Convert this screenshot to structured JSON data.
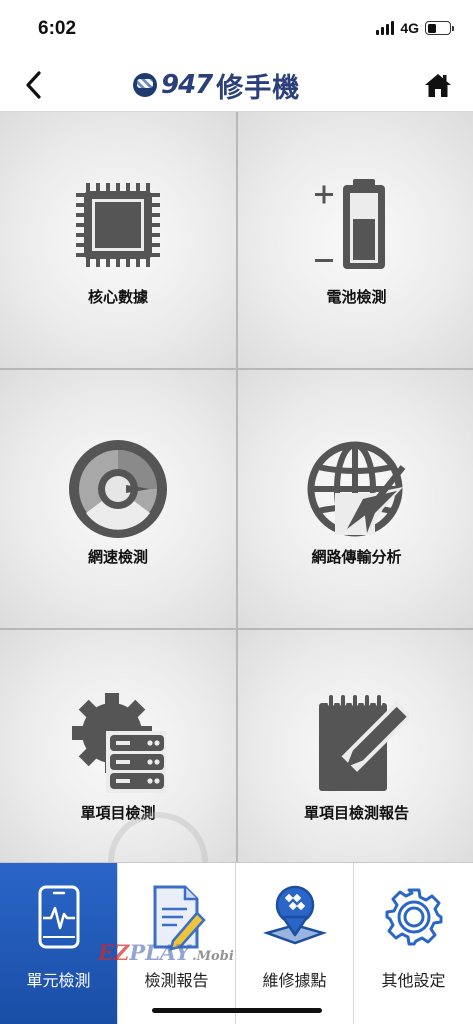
{
  "status_bar": {
    "time": "6:02",
    "network": "4G"
  },
  "nav": {
    "logo_number": "947",
    "logo_text": "修手機"
  },
  "tiles": [
    {
      "label": "核心數據",
      "icon": "cpu-chip-icon"
    },
    {
      "label": "電池檢測",
      "icon": "battery-level-icon"
    },
    {
      "label": "網速檢測",
      "icon": "speedometer-icon"
    },
    {
      "label": "網路傳輸分析",
      "icon": "globe-cursor-icon"
    },
    {
      "label": "單項目檢測",
      "icon": "gear-server-icon"
    },
    {
      "label": "單項目檢測報告",
      "icon": "notepad-pencil-icon"
    }
  ],
  "tabs": [
    {
      "label": "單元檢測",
      "icon": "phone-pulse-icon",
      "active": true
    },
    {
      "label": "檢測報告",
      "icon": "document-pen-icon",
      "active": false
    },
    {
      "label": "維修據點",
      "icon": "map-pin-cube-icon",
      "active": false
    },
    {
      "label": "其他設定",
      "icon": "settings-gear-icon",
      "active": false
    }
  ],
  "watermark": {
    "brand_ez": "EZ",
    "brand_play": "PLAY",
    "brand_suffix": ".Mobi"
  },
  "colors": {
    "brand_navy": "#2b3f7a",
    "tab_active": "#1f55b0",
    "icon_gray": "#555555"
  }
}
